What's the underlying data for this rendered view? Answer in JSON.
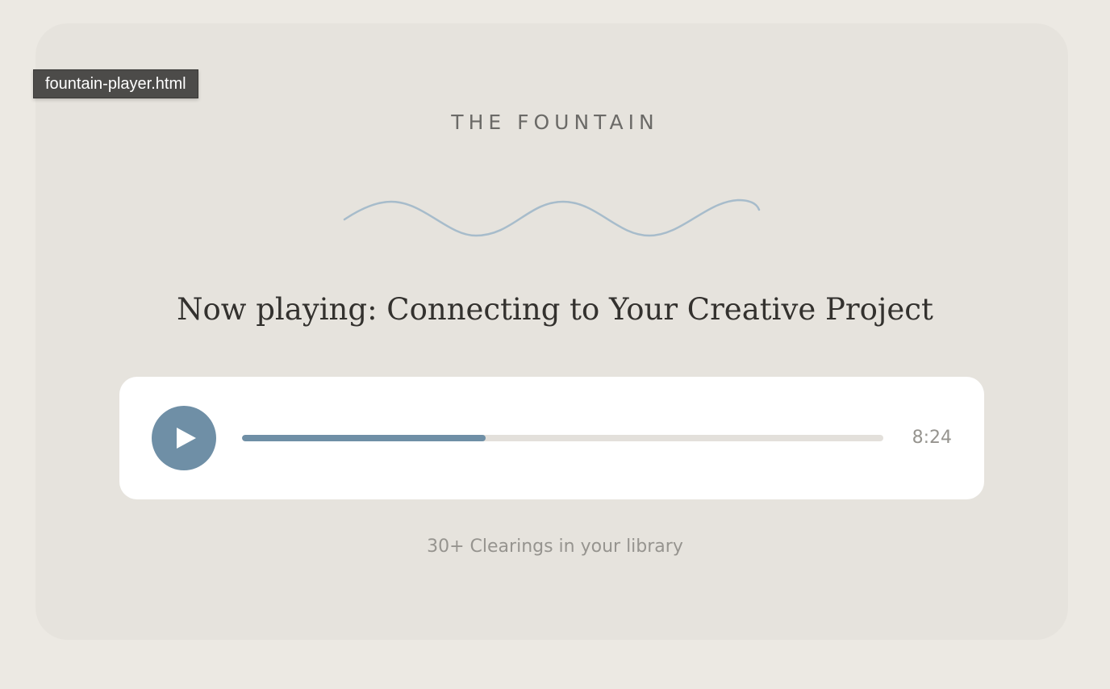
{
  "window": {
    "tab_label": "fountain-player.html"
  },
  "brand": {
    "name": "THE FOUNTAIN"
  },
  "player": {
    "now_playing": "Now playing: Connecting to Your Creative Project",
    "time": "8:24",
    "progress_fraction": 0.38
  },
  "footer": {
    "library_text": "30+ Clearings in your library"
  },
  "colors": {
    "accent": "#6f8fa6",
    "wave": "#a7bccb",
    "card": "#e6e3dd",
    "page": "#ece9e3",
    "text_dark": "#33312e",
    "text_muted": "#96948f"
  },
  "icons": {
    "play": "play-icon",
    "wave": "wave-divider"
  }
}
